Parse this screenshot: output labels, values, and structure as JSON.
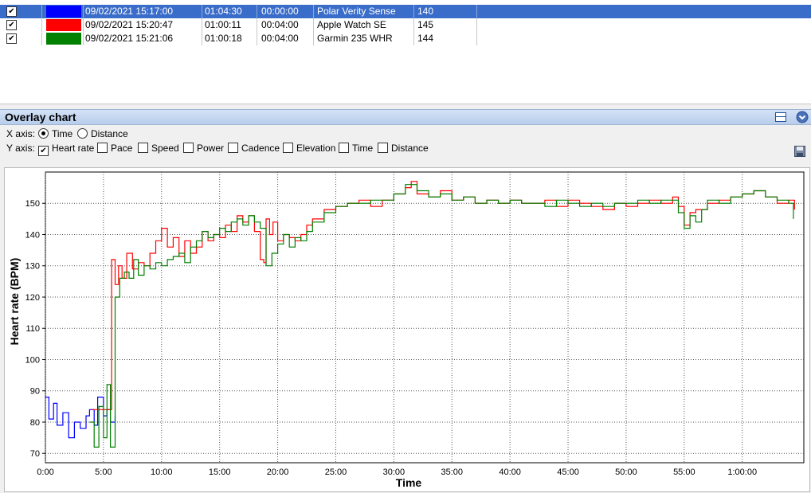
{
  "activities": [
    {
      "checked": true,
      "color": "#0000ff",
      "start": "09/02/2021 15:17:00",
      "duration": "01:04:30",
      "offset": "00:00:00",
      "device": "Polar Verity Sense",
      "avg_hr": "140",
      "selected": true
    },
    {
      "checked": true,
      "color": "#ff0000",
      "start": "09/02/2021 15:20:47",
      "duration": "01:00:11",
      "offset": "00:04:00",
      "device": "Apple Watch SE",
      "avg_hr": "145",
      "selected": false
    },
    {
      "checked": true,
      "color": "#008000",
      "start": "09/02/2021 15:21:06",
      "duration": "01:00:18",
      "offset": "00:04:00",
      "device": "Garmin 235 WHR",
      "avg_hr": "144",
      "selected": false
    }
  ],
  "panel": {
    "title": "Overlay chart",
    "x_axis_label": "X axis:",
    "y_axis_label": "Y axis:",
    "x_options": [
      {
        "label": "Time",
        "selected": true
      },
      {
        "label": "Distance",
        "selected": false
      }
    ],
    "y_options": [
      {
        "label": "Heart rate",
        "checked": true
      },
      {
        "label": "Pace",
        "checked": false
      },
      {
        "label": "Speed",
        "checked": false
      },
      {
        "label": "Power",
        "checked": false
      },
      {
        "label": "Cadence",
        "checked": false
      },
      {
        "label": "Elevation",
        "checked": false
      },
      {
        "label": "Time",
        "checked": false
      },
      {
        "label": "Distance",
        "checked": false
      }
    ]
  },
  "chart_data": {
    "type": "line",
    "xlabel": "Time",
    "ylabel": "Heart rate (BPM)",
    "x_ticks": [
      "0:00",
      "5:00",
      "10:00",
      "15:00",
      "20:00",
      "25:00",
      "30:00",
      "35:00",
      "40:00",
      "45:00",
      "50:00",
      "55:00",
      "1:00:00"
    ],
    "y_ticks": [
      70,
      80,
      90,
      100,
      110,
      120,
      130,
      140,
      150
    ],
    "xlim_min": [
      0,
      65.3
    ],
    "ylim": [
      67,
      160
    ],
    "grid": true,
    "series": [
      {
        "color": "#0000ff",
        "x_min": [
          0,
          0.3,
          0.7,
          1,
          1.5,
          2,
          2.5,
          3,
          3.5,
          3.8,
          4.2,
          4.5,
          5,
          5.3,
          5.6,
          6
        ],
        "y": [
          88,
          81,
          86,
          79,
          83,
          75,
          80,
          78,
          82,
          84,
          79,
          88,
          82,
          84,
          80,
          82
        ]
      },
      {
        "color": "#ff0000",
        "x_min": [
          4.0,
          5.2,
          5.7,
          6.0,
          6.3,
          6.6,
          7.0,
          7.5,
          8.0,
          8.5,
          9.0,
          9.5,
          10.0,
          10.5,
          11.0,
          11.5,
          12.0,
          12.5,
          13.0,
          13.5,
          14.0,
          14.5,
          15.0,
          15.5,
          16.0,
          16.5,
          17.0,
          17.5,
          18.0,
          18.5,
          18.8,
          19.0,
          19.3,
          19.6,
          20.0,
          20.5,
          21.0,
          21.5,
          22.0,
          22.5,
          23.0,
          24.0,
          25.0,
          26.0,
          27.0,
          28.0,
          29.0,
          30.0,
          31.0,
          31.5,
          32.0,
          33.0,
          34.0,
          35.0,
          36.0,
          37.0,
          38.0,
          39.0,
          40.0,
          41.0,
          42.0,
          43.0,
          44.0,
          45.0,
          46.0,
          47.0,
          48.0,
          49.0,
          50.0,
          51.0,
          52.0,
          53.0,
          54.0,
          54.5,
          55.0,
          55.5,
          56.0,
          57.0,
          58.0,
          59.0,
          60.0,
          61.0,
          62.0,
          63.0,
          64.0,
          64.5
        ],
        "y": [
          84,
          84,
          132,
          124,
          130,
          126,
          134,
          129,
          131,
          130,
          134,
          138,
          142,
          136,
          139,
          133,
          138,
          134,
          136,
          141,
          138,
          140,
          139,
          143,
          141,
          146,
          144,
          146,
          141,
          132,
          131,
          145,
          140,
          144,
          138,
          140,
          139,
          138,
          140,
          143,
          145,
          148,
          149,
          150,
          151,
          149,
          151,
          153,
          155,
          157,
          153,
          152,
          154,
          151,
          152,
          150,
          151,
          150,
          151,
          150,
          150,
          151,
          149,
          151,
          150,
          149,
          148,
          150,
          149,
          150,
          151,
          150,
          152,
          149,
          143,
          147,
          148,
          150,
          151,
          152,
          153,
          154,
          152,
          150,
          151,
          148
        ]
      },
      {
        "color": "#008000",
        "x_min": [
          3.8,
          4.2,
          4.6,
          5.0,
          5.3,
          5.6,
          6.0,
          6.4,
          6.8,
          7.2,
          7.6,
          8.0,
          8.5,
          9.0,
          9.5,
          10.0,
          10.5,
          11.0,
          11.5,
          12.0,
          12.5,
          13.0,
          13.5,
          14.0,
          14.5,
          15.0,
          15.5,
          16.0,
          16.5,
          17.0,
          17.5,
          18.0,
          18.5,
          19.0,
          19.5,
          20.0,
          20.5,
          21.0,
          21.5,
          22.0,
          22.5,
          23.0,
          24.0,
          25.0,
          26.0,
          27.0,
          28.0,
          29.0,
          30.0,
          31.0,
          32.0,
          33.0,
          34.0,
          35.0,
          36.0,
          37.0,
          38.0,
          39.0,
          40.0,
          41.0,
          42.0,
          43.0,
          44.0,
          45.0,
          46.0,
          47.0,
          48.0,
          49.0,
          50.0,
          51.0,
          52.0,
          53.0,
          54.0,
          54.5,
          55.0,
          55.5,
          56.0,
          56.5,
          57.0,
          58.0,
          59.0,
          60.0,
          61.0,
          62.0,
          63.0,
          64.0,
          64.4
        ],
        "y": [
          80,
          72,
          85,
          75,
          92,
          72,
          120,
          126,
          128,
          126,
          132,
          127,
          130,
          129,
          131,
          130,
          132,
          133,
          134,
          131,
          136,
          138,
          141,
          139,
          140,
          142,
          141,
          144,
          145,
          143,
          146,
          144,
          142,
          130,
          134,
          137,
          140,
          136,
          139,
          138,
          141,
          144,
          147,
          149,
          150,
          150,
          151,
          151,
          153,
          156,
          154,
          152,
          153,
          151,
          152,
          150,
          151,
          150,
          151,
          150,
          150,
          149,
          151,
          150,
          149,
          150,
          149,
          150,
          150,
          151,
          150,
          151,
          151,
          147,
          142,
          146,
          144,
          148,
          151,
          150,
          152,
          153,
          154,
          152,
          151,
          150,
          145
        ]
      }
    ]
  }
}
